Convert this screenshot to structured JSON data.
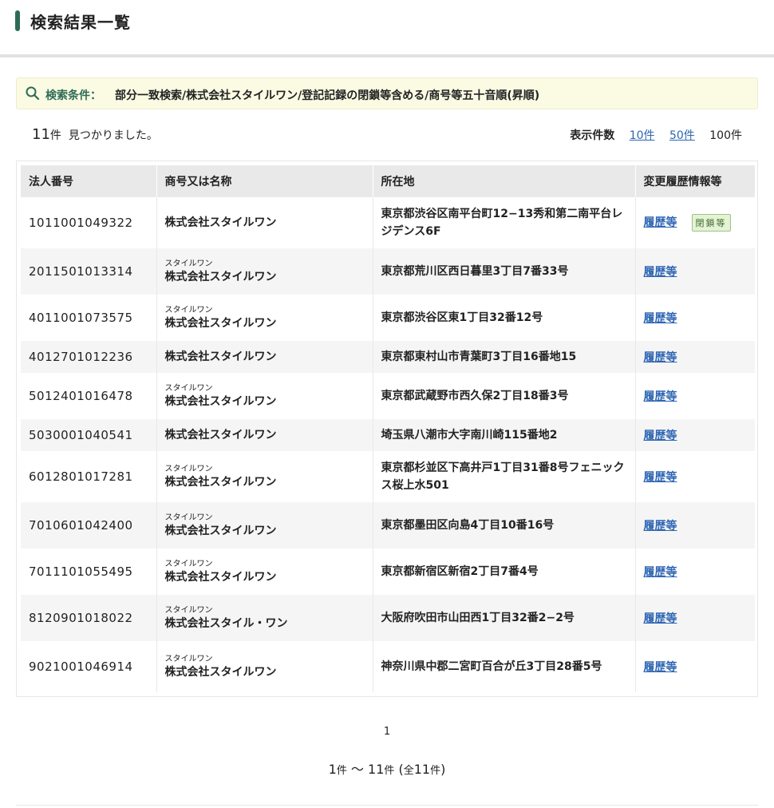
{
  "header": {
    "title": "検索結果一覧"
  },
  "condition": {
    "label": "検索条件：",
    "value": "部分一致検索/株式会社スタイルワン/登記記録の閉鎖等含める/商号等五十音順(昇順)"
  },
  "result_count": {
    "count": "11",
    "unit": "件",
    "suffix": "見つかりました。"
  },
  "per_page": {
    "label": "表示件数",
    "options": [
      "10件",
      "50件",
      "100件"
    ],
    "selected": "100件"
  },
  "table": {
    "headers": [
      "法人番号",
      "商号又は名称",
      "所在地",
      "変更履歴情報等"
    ],
    "history_link": "履歴等",
    "closed_badge": "閉鎖等",
    "rows": [
      {
        "number": "1011001049322",
        "kana": "",
        "name": "株式会社スタイルワン",
        "address": "東京都渋谷区南平台町12−13秀和第二南平台レジデンス6F",
        "closed": true
      },
      {
        "number": "2011501013314",
        "kana": "スタイルワン",
        "name": "株式会社スタイルワン",
        "address": "東京都荒川区西日暮里3丁目7番33号",
        "closed": false
      },
      {
        "number": "4011001073575",
        "kana": "スタイルワン",
        "name": "株式会社スタイルワン",
        "address": "東京都渋谷区東1丁目32番12号",
        "closed": false
      },
      {
        "number": "4012701012236",
        "kana": "",
        "name": "株式会社スタイルワン",
        "address": "東京都東村山市青葉町3丁目16番地15",
        "closed": false
      },
      {
        "number": "5012401016478",
        "kana": "スタイルワン",
        "name": "株式会社スタイルワン",
        "address": "東京都武蔵野市西久保2丁目18番3号",
        "closed": false
      },
      {
        "number": "5030001040541",
        "kana": "",
        "name": "株式会社スタイルワン",
        "address": "埼玉県八潮市大字南川崎115番地2",
        "closed": false
      },
      {
        "number": "6012801017281",
        "kana": "スタイルワン",
        "name": "株式会社スタイルワン",
        "address": "東京都杉並区下高井戸1丁目31番8号フェニックス桜上水501",
        "closed": false
      },
      {
        "number": "7010601042400",
        "kana": "スタイルワン",
        "name": "株式会社スタイルワン",
        "address": "東京都墨田区向島4丁目10番16号",
        "closed": false
      },
      {
        "number": "7011101055495",
        "kana": "スタイルワン",
        "name": "株式会社スタイルワン",
        "address": "東京都新宿区新宿2丁目7番4号",
        "closed": false
      },
      {
        "number": "8120901018022",
        "kana": "スタイルワン",
        "name": "株式会社スタイル・ワン",
        "address": "大阪府吹田市山田西1丁目32番2−2号",
        "closed": false
      },
      {
        "number": "9021001046914",
        "kana": "スタイルワン",
        "name": "株式会社スタイルワン",
        "address": "神奈川県中郡二宮町百合が丘3丁目28番5号",
        "closed": false
      }
    ]
  },
  "pagination": {
    "current_page": "1"
  },
  "range": {
    "start": "1",
    "end": "11",
    "total": "11"
  },
  "colors": {
    "accent": "#2e6b57",
    "link": "#2f66b3",
    "condition_bg": "#fbfbe3"
  },
  "icons": {
    "condition": "search-icon"
  }
}
